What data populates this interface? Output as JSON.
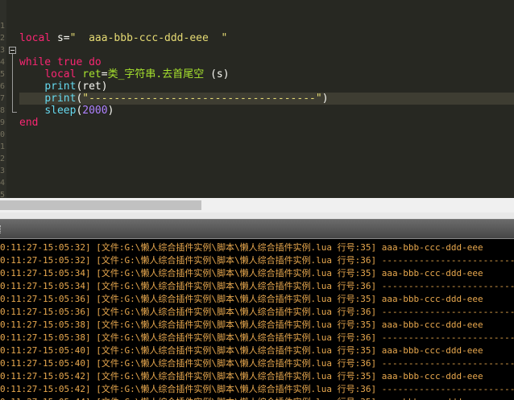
{
  "editor": {
    "line_numbers": [
      "1",
      "2",
      "3",
      "4",
      "5",
      "6",
      "7",
      "8",
      "9",
      "0",
      "1",
      "2",
      "3",
      "4",
      "5",
      "6"
    ],
    "lines": [
      [],
      [
        {
          "t": "local",
          "c": "kw"
        },
        {
          "t": " s=",
          "c": "pl"
        },
        {
          "t": "\"  aaa-bbb-ccc-ddd-eee  \"",
          "c": "str"
        }
      ],
      [],
      [
        {
          "t": "while",
          "c": "kw"
        },
        {
          "t": " ",
          "c": "pl"
        },
        {
          "t": "true",
          "c": "kw"
        },
        {
          "t": " ",
          "c": "pl"
        },
        {
          "t": "do",
          "c": "kw"
        }
      ],
      [
        {
          "t": "    ",
          "c": "pl"
        },
        {
          "t": "local",
          "c": "kw"
        },
        {
          "t": " ",
          "c": "pl"
        },
        {
          "t": "ret",
          "c": "id"
        },
        {
          "t": "=",
          "c": "pl"
        },
        {
          "t": "类_字符串.去首尾空",
          "c": "id"
        },
        {
          "t": " (s)",
          "c": "pl"
        }
      ],
      [
        {
          "t": "    ",
          "c": "pl"
        },
        {
          "t": "print",
          "c": "fn"
        },
        {
          "t": "(ret)",
          "c": "pl"
        }
      ],
      [
        {
          "t": "    ",
          "c": "pl"
        },
        {
          "t": "print",
          "c": "fn"
        },
        {
          "t": "(",
          "c": "pl"
        },
        {
          "t": "\"------------------------------------\"",
          "c": "str"
        },
        {
          "t": ")",
          "c": "pl"
        }
      ],
      [
        {
          "t": "    ",
          "c": "pl"
        },
        {
          "t": "sleep",
          "c": "fn"
        },
        {
          "t": "(",
          "c": "pl"
        },
        {
          "t": "2000",
          "c": "num"
        },
        {
          "t": ")",
          "c": "pl"
        }
      ],
      [
        {
          "t": "end",
          "c": "kw"
        }
      ],
      [],
      [],
      [],
      [],
      [],
      [],
      []
    ]
  },
  "output": {
    "rows": [
      "0:11:27-15:05:32] [文件:G:\\懒人综合插件实例\\脚本\\懒人综合插件实例.lua 行号:35] aaa-bbb-ccc-ddd-eee",
      "0:11:27-15:05:32] [文件:G:\\懒人综合插件实例\\脚本\\懒人综合插件实例.lua 行号:36] ------------------------------------",
      "0:11:27-15:05:34] [文件:G:\\懒人综合插件实例\\脚本\\懒人综合插件实例.lua 行号:35] aaa-bbb-ccc-ddd-eee",
      "0:11:27-15:05:34] [文件:G:\\懒人综合插件实例\\脚本\\懒人综合插件实例.lua 行号:36] ------------------------------------",
      "0:11:27-15:05:36] [文件:G:\\懒人综合插件实例\\脚本\\懒人综合插件实例.lua 行号:35] aaa-bbb-ccc-ddd-eee",
      "0:11:27-15:05:36] [文件:G:\\懒人综合插件实例\\脚本\\懒人综合插件实例.lua 行号:36] ------------------------------------",
      "0:11:27-15:05:38] [文件:G:\\懒人综合插件实例\\脚本\\懒人综合插件实例.lua 行号:35] aaa-bbb-ccc-ddd-eee",
      "0:11:27-15:05:38] [文件:G:\\懒人综合插件实例\\脚本\\懒人综合插件实例.lua 行号:36] ------------------------------------",
      "0:11:27-15:05:40] [文件:G:\\懒人综合插件实例\\脚本\\懒人综合插件实例.lua 行号:35] aaa-bbb-ccc-ddd-eee",
      "0:11:27-15:05:40] [文件:G:\\懒人综合插件实例\\脚本\\懒人综合插件实例.lua 行号:36] ------------------------------------",
      "0:11:27-15:05:42] [文件:G:\\懒人综合插件实例\\脚本\\懒人综合插件实例.lua 行号:35] aaa-bbb-ccc-ddd-eee",
      "0:11:27-15:05:42] [文件:G:\\懒人综合插件实例\\脚本\\懒人综合插件实例.lua 行号:36] ------------------------------------",
      "0:11:27-15:05:44] [文件:G:\\懒人综合插件实例\\脚本\\懒人综合插件实例.lua 行号:35] aaa-bbb-ccc-ddd-eee"
    ]
  },
  "colors": {
    "editor_bg": "#272822",
    "keyword": "#f92672",
    "function": "#66d9ef",
    "string": "#e6db74",
    "identifier": "#a6e22e",
    "number": "#ae81ff",
    "output_text": "#e8a84e",
    "output_bg": "#000000"
  },
  "icons": [
    "fold-collapse-icon"
  ]
}
